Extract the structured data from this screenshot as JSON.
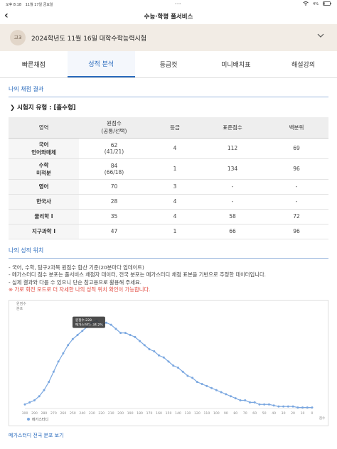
{
  "status_bar": {
    "time": "오후 8:18",
    "date": "11월 17일 금요일",
    "dots": "•••",
    "battery": "4%"
  },
  "nav": {
    "title": "수능·학평 풀서비스"
  },
  "exam": {
    "grade": "고3",
    "title": "2024학년도 11월 16일 대학수학능력시험"
  },
  "tabs": [
    {
      "label": "빠른채점"
    },
    {
      "label": "성적 분석"
    },
    {
      "label": "등급컷"
    },
    {
      "label": "미니배치표"
    },
    {
      "label": "해설강의"
    }
  ],
  "results": {
    "section_title": "나의 채점 결과",
    "type_line": "❯ 시험지 유형 : [홀수형]",
    "headers": {
      "area": "영역",
      "raw": "원점수",
      "raw_sub": "(공통/선택)",
      "grade": "등급",
      "std": "표준점수",
      "pct": "백분위"
    },
    "rows": [
      {
        "subject": "국어",
        "subject2": "언어와매체",
        "raw": "62",
        "raw_sub": "(41/21)",
        "grade": "4",
        "std": "112",
        "pct": "69"
      },
      {
        "subject": "수학",
        "subject2": "미적분",
        "raw": "84",
        "raw_sub": "(66/18)",
        "grade": "1",
        "std": "134",
        "pct": "96"
      },
      {
        "subject": "영어",
        "subject2": "",
        "raw": "70",
        "raw_sub": "",
        "grade": "3",
        "std": "-",
        "pct": "-"
      },
      {
        "subject": "한국사",
        "subject2": "",
        "raw": "28",
        "raw_sub": "",
        "grade": "4",
        "std": "-",
        "pct": "-"
      },
      {
        "subject": "물리학 I",
        "subject2": "",
        "raw": "35",
        "raw_sub": "",
        "grade": "4",
        "std": "58",
        "pct": "72"
      },
      {
        "subject": "지구과학 I",
        "subject2": "",
        "raw": "47",
        "raw_sub": "",
        "grade": "1",
        "std": "66",
        "pct": "96"
      }
    ]
  },
  "position": {
    "section_title": "나의 성적 위치",
    "notes": [
      "- 국어, 수학, 탐구2과목 원점수 합산 기준(20분마다 업데이트)",
      "- 메가스터디 점수 분포는 풀서비스 채점자 데이터, 전국 분포는 메가스터디 채점 표본을 기반으로 추정한 데이터입니다.",
      "- 실제 결과와 다를 수 있으니 단순 참고용으로 활용해 주세요."
    ],
    "warning": "※ 가로 회전 모드로 더 자세한 나의 성적 위치 확인이 가능합니다.",
    "more_label": "메가스터디 전국 분포 보기"
  },
  "chart_data": {
    "type": "line",
    "ylabel": "원점수\n분포",
    "xlabel": "점수",
    "x": [
      300,
      295,
      290,
      285,
      280,
      275,
      270,
      265,
      260,
      255,
      250,
      245,
      240,
      235,
      230,
      225,
      220,
      215,
      210,
      205,
      200,
      195,
      190,
      185,
      180,
      175,
      170,
      165,
      160,
      155,
      150,
      145,
      140,
      135,
      130,
      125,
      120,
      115,
      110,
      105,
      100,
      95,
      90,
      85,
      80,
      75,
      70,
      65,
      60,
      55,
      50,
      45,
      40,
      35,
      30,
      25,
      20,
      15,
      10,
      5,
      0
    ],
    "x_tick_labels": [
      "300",
      "290",
      "280",
      "270",
      "260",
      "250",
      "240",
      "230",
      "220",
      "210",
      "200",
      "190",
      "180",
      "170",
      "160",
      "150",
      "140",
      "130",
      "120",
      "110",
      "100",
      "90",
      "80",
      "70",
      "60",
      "50",
      "40",
      "30",
      "20",
      "10",
      "0"
    ],
    "series": [
      {
        "name": "메가스터디",
        "color": "#7aa7e0",
        "values": [
          2,
          3,
          4,
          6,
          9,
          13,
          18,
          23,
          27,
          31,
          34,
          36,
          38,
          40,
          42,
          43,
          41,
          42,
          41,
          39,
          37,
          37,
          36,
          35,
          33,
          31,
          29,
          28,
          26,
          25,
          23,
          21,
          20,
          18,
          16,
          15,
          13,
          12,
          11,
          10,
          9,
          8,
          7,
          6,
          5,
          4,
          4,
          3,
          3,
          2,
          2,
          2,
          1.5,
          1,
          1,
          1,
          1,
          0.5,
          0.5,
          0.5,
          0.5
        ]
      }
    ],
    "tooltip": {
      "title": "원점수:228",
      "line": "메가스터디: 34.2%"
    },
    "ylim": [
      0,
      48
    ]
  }
}
